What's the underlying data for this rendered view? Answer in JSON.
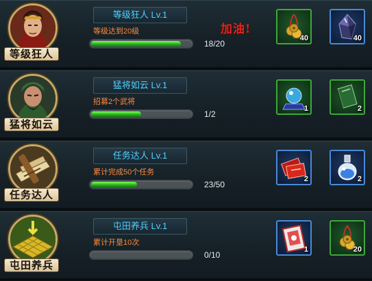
{
  "cheer_text": "加油!",
  "achievements": [
    {
      "name_plate": "等级狂人",
      "title": "等级狂人 Lv.1",
      "goal": "等级达到20级",
      "progress": 0.9,
      "count": "18/20",
      "rewards": [
        {
          "icon": "coin-string-icon",
          "frame": "green",
          "qty": "40"
        },
        {
          "icon": "dark-crystal-icon",
          "frame": "blue",
          "qty": "40"
        }
      ]
    },
    {
      "name_plate": "猛将如云",
      "title": "猛将如云 Lv.1",
      "goal": "招募2个武将",
      "progress": 0.5,
      "count": "1/2",
      "rewards": [
        {
          "icon": "crystal-ball-icon",
          "frame": "green",
          "qty": "1"
        },
        {
          "icon": "green-book-icon",
          "frame": "green",
          "qty": "2"
        }
      ]
    },
    {
      "name_plate": "任务达人",
      "title": "任务达人 Lv.1",
      "goal": "累计完成50个任务",
      "progress": 0.46,
      "count": "23/50",
      "rewards": [
        {
          "icon": "red-tickets-icon",
          "frame": "blue",
          "qty": "2"
        },
        {
          "icon": "potion-bottle-icon",
          "frame": "blue",
          "qty": "2"
        }
      ]
    },
    {
      "name_plate": "屯田养兵",
      "title": "屯田养兵 Lv.1",
      "goal": "累计开垦10次",
      "progress": 0,
      "count": "0/10",
      "rewards": [
        {
          "icon": "red-card-icon",
          "frame": "blue",
          "qty": "1"
        },
        {
          "icon": "coin-string-icon",
          "frame": "green",
          "qty": "20"
        }
      ]
    }
  ]
}
